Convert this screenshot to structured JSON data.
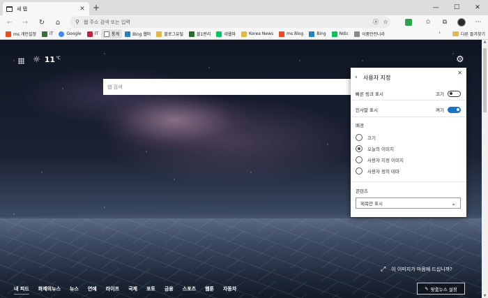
{
  "browser": {
    "tab": {
      "title": "새 탭",
      "close_glyph": "✕"
    },
    "new_tab_glyph": "+",
    "window_controls": {
      "minimize": "—",
      "maximize": "☐",
      "close": "✕"
    },
    "toolbar": {
      "back": "←",
      "forward": "→",
      "refresh": "↻",
      "home": "⌂",
      "address_placeholder": "웹 주소 검색 또는 입력",
      "right_icons": [
        "translate-icon",
        "favorite-star-icon",
        "extension-icon",
        "favorites-icon",
        "collections-icon",
        "profile-icon",
        "menu-icon"
      ]
    },
    "favorites": [
      {
        "label": "ms 개인설정",
        "icon": "ms-icon",
        "color": "#e94b25"
      },
      {
        "label": "IT",
        "icon": "it-icon",
        "color": "#3b6e3b"
      },
      {
        "label": "Google",
        "icon": "google-icon",
        "color": "#4285f4"
      },
      {
        "label": "IT",
        "icon": "it2-icon",
        "color": "#c0223e"
      },
      {
        "label": "통계",
        "icon": "doc-icon",
        "color": "#777777",
        "active": true
      },
      {
        "label": "Bing 웹마",
        "icon": "bing-icon",
        "color": "#2a7fbf"
      },
      {
        "label": "블로그유틸",
        "icon": "folder-icon",
        "color": "#e5b743"
      },
      {
        "label": "블1판리",
        "icon": "blog-icon",
        "color": "#2d6a2d"
      },
      {
        "label": "네웹마",
        "icon": "naver-icon",
        "color": "#03c75a"
      },
      {
        "label": "Korea News",
        "icon": "folder-icon",
        "color": "#e5b743"
      },
      {
        "label": "ms Blog",
        "icon": "ms-icon",
        "color": "#e94b25"
      },
      {
        "label": "Bing",
        "icon": "bing-icon",
        "color": "#2a7fbf"
      },
      {
        "label": "Ndic",
        "icon": "naver-icon",
        "color": "#03c75a"
      },
      {
        "label": "식품안전나라",
        "icon": "food-icon",
        "color": "#888888"
      }
    ],
    "favorites_more": "›",
    "other_favorites": "다른 즐겨찾기"
  },
  "page": {
    "weather": {
      "temp": "11",
      "unit": "℃"
    },
    "search_placeholder": "웹 검색",
    "image_like": "이 이미지가 마음에 드십니까?",
    "nav": [
      "내 피드",
      "화제의뉴스",
      "뉴스",
      "연예",
      "라이프",
      "국제",
      "포토",
      "금융",
      "스포츠",
      "웹툰",
      "자동차"
    ],
    "news_button": "맞춤뉴스 설정"
  },
  "panel": {
    "title": "사용자 지정",
    "quick_links": {
      "label": "빠른 링크 표시",
      "state": "끄기",
      "on": false
    },
    "greeting": {
      "label": "인사말 표시",
      "state": "켜기",
      "on": true
    },
    "background": {
      "label": "배경",
      "options": [
        {
          "label": "끄기",
          "checked": false
        },
        {
          "label": "오늘의 이미지",
          "checked": true
        },
        {
          "label": "사용자 지정 이미지",
          "checked": false
        },
        {
          "label": "사용자 정의 테마",
          "checked": false
        }
      ]
    },
    "content": {
      "label": "콘텐츠",
      "selected": "제목만 표시"
    }
  },
  "colors": {
    "accent": "#1a73c7",
    "toggle_off": "#333333"
  }
}
